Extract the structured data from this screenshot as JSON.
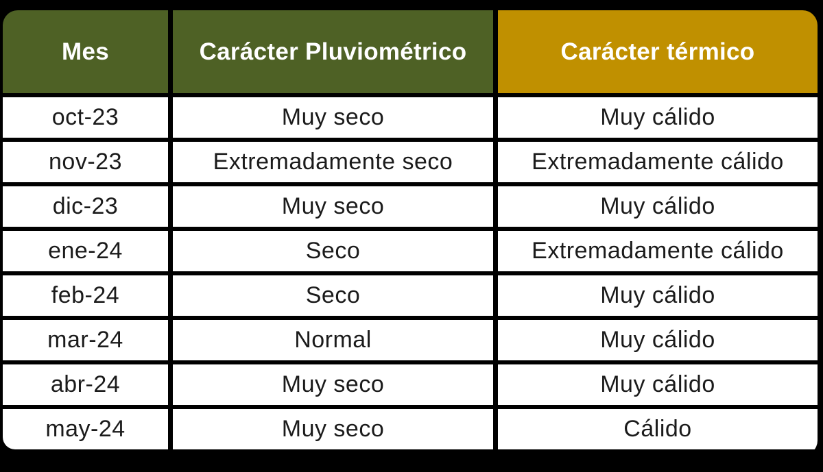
{
  "table": {
    "headers": [
      "Mes",
      "Carácter Pluviométrico",
      "Carácter térmico"
    ],
    "header_colors": {
      "mes": "#4e6125",
      "pluviometrico": "#4e6125",
      "termico": "#c09000"
    },
    "rows": [
      [
        "oct-23",
        "Muy seco",
        "Muy cálido"
      ],
      [
        "nov-23",
        "Extremadamente seco",
        "Extremadamente cálido"
      ],
      [
        "dic-23",
        "Muy seco",
        "Muy cálido"
      ],
      [
        "ene-24",
        "Seco",
        "Extremadamente cálido"
      ],
      [
        "feb-24",
        "Seco",
        "Muy cálido"
      ],
      [
        "mar-24",
        "Normal",
        "Muy cálido"
      ],
      [
        "abr-24",
        "Muy seco",
        "Muy cálido"
      ],
      [
        "may-24",
        "Muy seco",
        "Cálido"
      ]
    ]
  }
}
